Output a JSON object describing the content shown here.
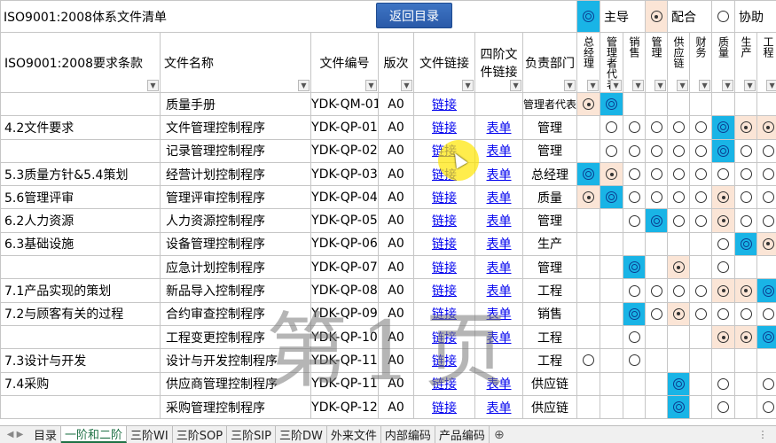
{
  "title": "ISO9001:2008体系文件清单",
  "return_button": "返回目录",
  "legend": {
    "main_label": "主导",
    "coop_label": "配合",
    "assist_label": "协助"
  },
  "headers": {
    "req": "ISO9001:2008要求条款",
    "name": "文件名称",
    "code": "文件编号",
    "ver": "版次",
    "link": "文件链接",
    "fourth_line1": "四阶文",
    "fourth_line2": "件链接",
    "dept": "负责部门",
    "roles": [
      "总经理",
      "管理者代表",
      "销售",
      "管理",
      "供应链",
      "财务",
      "质量",
      "生产",
      "工程"
    ]
  },
  "link_text": "链接",
  "form_text": "表单",
  "rows": [
    {
      "req": "",
      "name": "质量手册",
      "code": "YDK-QM-01",
      "ver": "A0",
      "form": false,
      "dept": "管理者代表",
      "roles": [
        "dot",
        "dbl",
        "",
        "",
        "",
        "",
        "",
        "",
        ""
      ]
    },
    {
      "req": "4.2文件要求",
      "name": "文件管理控制程序",
      "code": "YDK-QP-01",
      "ver": "A0",
      "form": true,
      "dept": "管理",
      "roles": [
        "",
        "o",
        "o",
        "o",
        "o",
        "o",
        "dbl",
        "dot",
        "dot"
      ]
    },
    {
      "req": "",
      "name": "记录管理控制程序",
      "code": "YDK-QP-02",
      "ver": "A0",
      "form": true,
      "dept": "管理",
      "roles": [
        "",
        "o",
        "o",
        "o",
        "o",
        "o",
        "dbl",
        "o",
        "o"
      ]
    },
    {
      "req": "5.3质量方针&5.4策划",
      "name": "经营计划控制程序",
      "code": "YDK-QP-03",
      "ver": "A0",
      "form": true,
      "dept": "总经理",
      "roles": [
        "dbl",
        "dot",
        "o",
        "o",
        "o",
        "o",
        "o",
        "o",
        "o"
      ]
    },
    {
      "req": "5.6管理评审",
      "name": "管理评审控制程序",
      "code": "YDK-QP-04",
      "ver": "A0",
      "form": true,
      "dept": "质量",
      "roles": [
        "dot",
        "dbl",
        "o",
        "o",
        "o",
        "o",
        "dot",
        "o",
        "o"
      ]
    },
    {
      "req": "6.2人力资源",
      "name": "人力资源控制程序",
      "code": "YDK-QP-05",
      "ver": "A0",
      "form": true,
      "dept": "管理",
      "roles": [
        "",
        "",
        "o",
        "dbl",
        "o",
        "o",
        "dot",
        "o",
        "o"
      ]
    },
    {
      "req": "6.3基础设施",
      "name": "设备管理控制程序",
      "code": "YDK-QP-06",
      "ver": "A0",
      "form": true,
      "dept": "生产",
      "roles": [
        "",
        "",
        "",
        "",
        "",
        "",
        "o",
        "dbl",
        "dot"
      ]
    },
    {
      "req": "",
      "name": "应急计划控制程序",
      "code": "YDK-QP-07",
      "ver": "A0",
      "form": true,
      "dept": "管理",
      "roles": [
        "",
        "",
        "dbl",
        "",
        "dot",
        "",
        "o",
        "",
        ""
      ]
    },
    {
      "req": "7.1产品实现的策划",
      "name": "新品导入控制程序",
      "code": "YDK-QP-08",
      "ver": "A0",
      "form": true,
      "dept": "工程",
      "roles": [
        "",
        "",
        "o",
        "o",
        "o",
        "o",
        "dot",
        "dot",
        "dbl"
      ]
    },
    {
      "req": "7.2与顾客有关的过程",
      "name": "合约审查控制程序",
      "code": "YDK-QP-09",
      "ver": "A0",
      "form": true,
      "dept": "销售",
      "roles": [
        "",
        "",
        "dbl",
        "o",
        "dot",
        "o",
        "o",
        "o",
        "o"
      ]
    },
    {
      "req": "",
      "name": "工程变更控制程序",
      "code": "YDK-QP-10",
      "ver": "A0",
      "form": true,
      "dept": "工程",
      "roles": [
        "",
        "",
        "o",
        "",
        "",
        "",
        "dot",
        "dot",
        "dbl"
      ]
    },
    {
      "req": "7.3设计与开发",
      "name": "设计与开发控制程序",
      "code": "YDK-QP-11",
      "ver": "A0",
      "form": false,
      "dept": "工程",
      "roles": [
        "o",
        "",
        "o",
        "",
        "",
        "",
        "",
        "",
        ""
      ]
    },
    {
      "req": "7.4采购",
      "name": "供应商管理控制程序",
      "code": "YDK-QP-11",
      "ver": "A0",
      "form": true,
      "dept": "供应链",
      "roles": [
        "",
        "",
        "",
        "",
        "dbl",
        "",
        "o",
        "",
        "o"
      ]
    },
    {
      "req": "",
      "name": "采购管理控制程序",
      "code": "YDK-QP-12",
      "ver": "A0",
      "form": true,
      "dept": "供应链",
      "roles": [
        "",
        "",
        "",
        "",
        "dbl",
        "",
        "o",
        "",
        "o"
      ]
    }
  ],
  "watermark": "第1页",
  "tabs": [
    "目录",
    "一阶和二阶",
    "三阶WI",
    "三阶SOP",
    "三阶SIP",
    "三阶DW",
    "外来文件",
    "内部编码",
    "产品编码"
  ],
  "active_tab": "一阶和二阶"
}
